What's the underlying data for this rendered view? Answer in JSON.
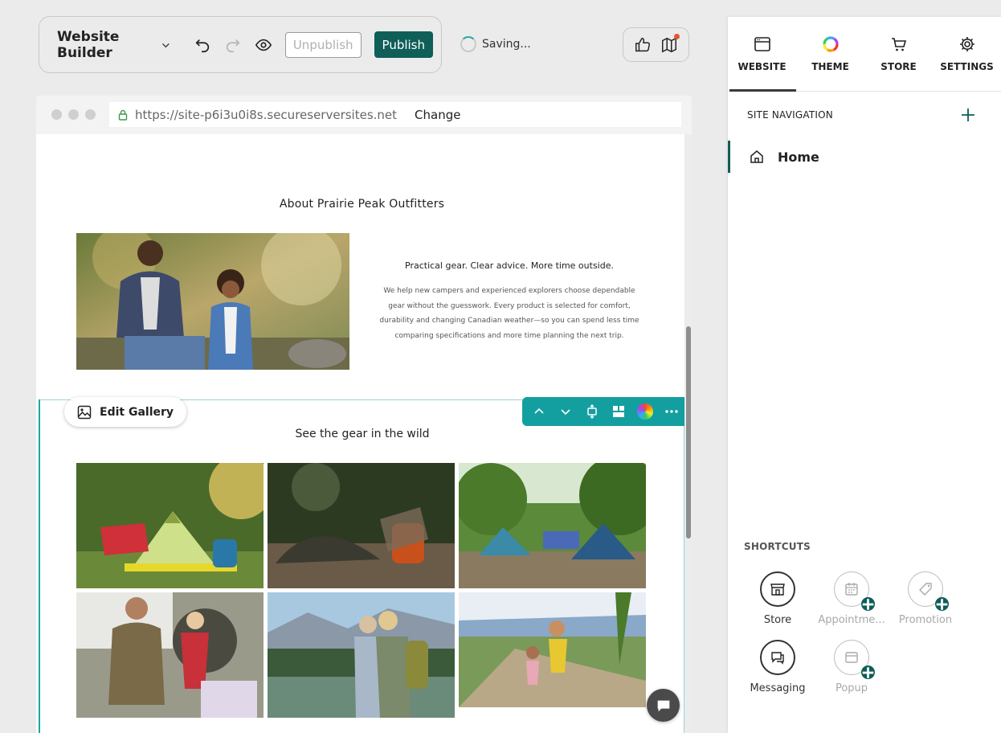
{
  "toolbar": {
    "title": "Website Builder",
    "unpublish_label": "Unpublish",
    "publish_label": "Publish",
    "status": "Saving..."
  },
  "browser": {
    "url": "https://site-p6i3u0i8s.secureserversites.net",
    "change_label": "Change"
  },
  "site": {
    "about": {
      "title": "About Prairie Peak Outfitters",
      "tagline": "Practical gear. Clear advice. More time outside.",
      "body": "We help new campers and experienced explorers choose dependable gear without the guesswork. Every product is selected for comfort, durability and changing Canadian weather—so you can spend less time comparing specifications and more time planning the next trip."
    },
    "gallery": {
      "title": "See the gear in the wild",
      "edit_label": "Edit Gallery"
    }
  },
  "panel": {
    "tabs": [
      {
        "label": "WEBSITE",
        "icon": "browser-window-icon"
      },
      {
        "label": "THEME",
        "icon": "color-ring-icon"
      },
      {
        "label": "STORE",
        "icon": "cart-icon"
      },
      {
        "label": "SETTINGS",
        "icon": "gear-icon"
      }
    ],
    "nav_header": "SITE NAVIGATION",
    "nav_items": [
      {
        "label": "Home",
        "icon": "home-icon"
      }
    ],
    "shortcuts_title": "SHORTCUTS",
    "shortcuts": [
      {
        "label": "Store",
        "icon": "storefront-icon"
      },
      {
        "label": "Appointme...",
        "icon": "calendar-icon"
      },
      {
        "label": "Promotion",
        "icon": "tag-icon"
      },
      {
        "label": "Messaging",
        "icon": "chat-icon"
      },
      {
        "label": "Popup",
        "icon": "popup-window-icon"
      }
    ]
  },
  "colors": {
    "accent": "#0f5e58",
    "section_tools": "#139f9f",
    "notification_dot": "#e4572e"
  }
}
